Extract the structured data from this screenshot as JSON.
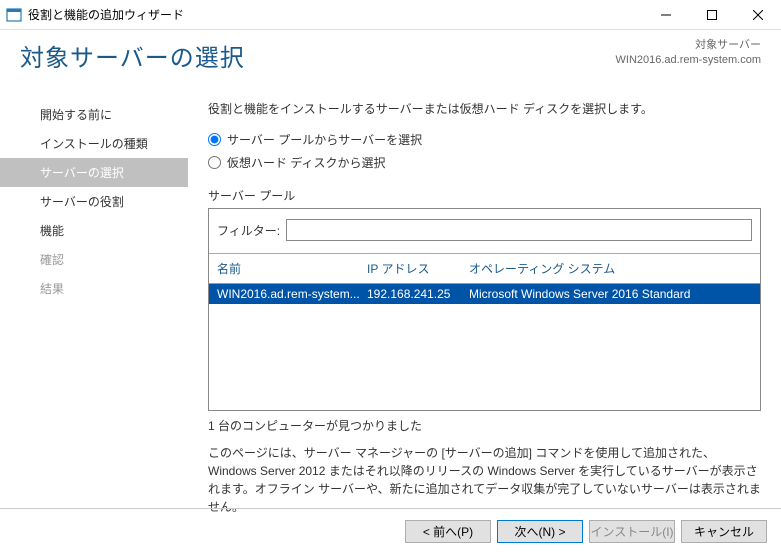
{
  "window": {
    "title": "役割と機能の追加ウィザード"
  },
  "header": {
    "page_title": "対象サーバーの選択",
    "target_label": "対象サーバー",
    "target_server": "WIN2016.ad.rem-system.com"
  },
  "sidebar": {
    "items": [
      {
        "label": "開始する前に",
        "state": "normal"
      },
      {
        "label": "インストールの種類",
        "state": "normal"
      },
      {
        "label": "サーバーの選択",
        "state": "selected"
      },
      {
        "label": "サーバーの役割",
        "state": "normal"
      },
      {
        "label": "機能",
        "state": "normal"
      },
      {
        "label": "確認",
        "state": "dim"
      },
      {
        "label": "結果",
        "state": "dim"
      }
    ]
  },
  "content": {
    "instruction": "役割と機能をインストールするサーバーまたは仮想ハード ディスクを選択します。",
    "radio1": "サーバー プールからサーバーを選択",
    "radio2": "仮想ハード ディスクから選択",
    "pool_label": "サーバー プール",
    "filter_label": "フィルター:",
    "filter_value": "",
    "columns": {
      "name": "名前",
      "ip": "IP アドレス",
      "os": "オペレーティング システム"
    },
    "rows": [
      {
        "name": "WIN2016.ad.rem-system...",
        "ip": "192.168.241.25",
        "os": "Microsoft Windows Server 2016 Standard"
      }
    ],
    "found_text": "1 台のコンピューターが見つかりました",
    "desc_text": "このページには、サーバー マネージャーの [サーバーの追加] コマンドを使用して追加された、Windows Server 2012 またはそれ以降のリリースの Windows Server を実行しているサーバーが表示されます。オフライン サーバーや、新たに追加されてデータ収集が完了していないサーバーは表示されません。"
  },
  "footer": {
    "prev": "< 前へ(P)",
    "next": "次へ(N) >",
    "install": "インストール(I)",
    "cancel": "キャンセル"
  }
}
